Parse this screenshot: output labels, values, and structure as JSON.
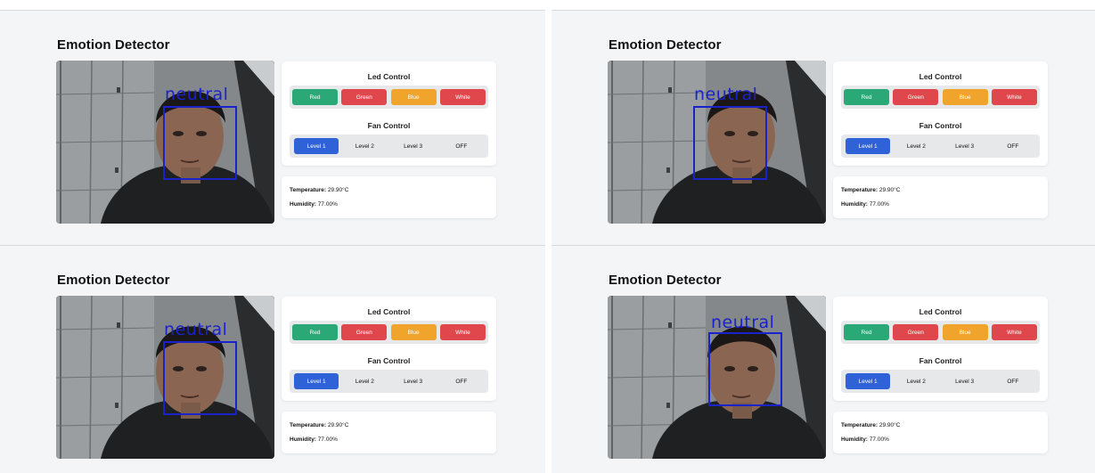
{
  "app": {
    "title": "Emotion Detector"
  },
  "colors": {
    "background": "#f4f5f6",
    "red": "#e0474c",
    "green": "#2aa876",
    "blue": "#f0a42c",
    "white": "#e0474c",
    "active": "#2f62d6",
    "detection_box": "#1a22c9"
  },
  "led_control": {
    "title": "Led Control",
    "buttons": [
      "Red",
      "Green",
      "Blue",
      "White"
    ]
  },
  "fan_control": {
    "title": "Fan Control",
    "buttons": [
      "Level 1",
      "Level 2",
      "Level 3",
      "OFF"
    ],
    "active": "Level 1"
  },
  "sensors": {
    "temperature_label": "Temperature:",
    "temperature_value": "29.90°C",
    "humidity_label": "Humidity:",
    "humidity_value": "77.00%"
  },
  "panels": [
    {
      "emotion": "neutral",
      "led_colors": [
        "#2aa876",
        "#e0474c",
        "#f0a42c",
        "#e0474c"
      ]
    },
    {
      "emotion": "neutral",
      "led_colors": [
        "#2aa876",
        "#e0474c",
        "#f0a42c",
        "#e0474c"
      ]
    },
    {
      "emotion": "neutral",
      "led_colors": [
        "#2aa876",
        "#e0474c",
        "#f0a42c",
        "#e0474c"
      ]
    },
    {
      "emotion": "neutral",
      "led_colors": [
        "#2aa876",
        "#e0474c",
        "#f0a42c",
        "#e0474c"
      ]
    }
  ]
}
